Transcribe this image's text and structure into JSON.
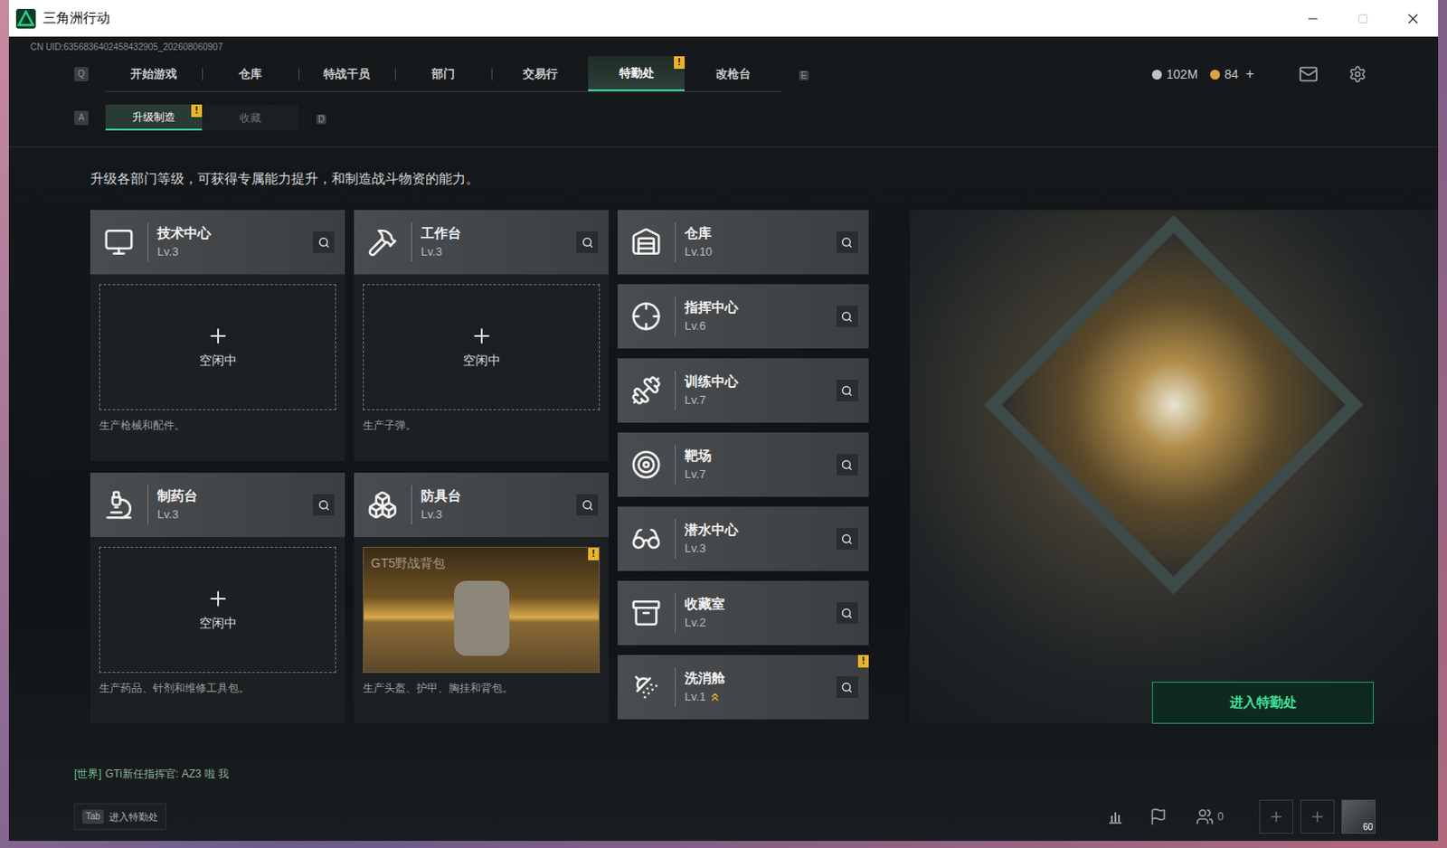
{
  "window": {
    "title": "三角洲行动"
  },
  "uid": "CN UID:6356836402458432905_202608060907",
  "nav": {
    "prev_key": "Q",
    "next_key": "E",
    "tabs": [
      {
        "label": "开始游戏",
        "selected": false
      },
      {
        "label": "仓库",
        "selected": false
      },
      {
        "label": "特战干员",
        "selected": false
      },
      {
        "label": "部门",
        "selected": false
      },
      {
        "label": "交易行",
        "selected": false
      },
      {
        "label": "特勤处",
        "selected": true,
        "badge": "!"
      },
      {
        "label": "改枪台",
        "selected": false
      }
    ]
  },
  "wallet": {
    "currencies": [
      {
        "value": "102M",
        "color": "#bfc3c6"
      },
      {
        "value": "84",
        "color": "#d9a441"
      }
    ],
    "add": "+"
  },
  "subnav": {
    "prev_key": "A",
    "next_key": "D",
    "tabs": [
      {
        "label": "升级制造",
        "selected": true,
        "badge": "!"
      },
      {
        "label": "收藏",
        "selected": false
      }
    ]
  },
  "description": "升级各部门等级，可获得专属能力提升，和制造战斗物资的能力。",
  "stations": [
    {
      "name": "技术中心",
      "level": "Lv.3",
      "slot": {
        "kind": "idle",
        "label": "空闲中"
      },
      "desc": "生产枪械和配件。"
    },
    {
      "name": "工作台",
      "level": "Lv.3",
      "slot": {
        "kind": "idle",
        "label": "空闲中"
      },
      "desc": "生产子弹。"
    },
    {
      "name": "制药台",
      "level": "Lv.3",
      "slot": {
        "kind": "idle",
        "label": "空闲中"
      },
      "desc": "生产药品、针剂和维修工具包。"
    },
    {
      "name": "防具台",
      "level": "Lv.3",
      "slot": {
        "kind": "item",
        "label": "GT5野战背包",
        "badge": "!"
      },
      "desc": "生产头盔、护甲、胸挂和背包。"
    }
  ],
  "departments": [
    {
      "name": "仓库",
      "level": "Lv.10",
      "upgradable": false
    },
    {
      "name": "指挥中心",
      "level": "Lv.6",
      "upgradable": false
    },
    {
      "name": "训练中心",
      "level": "Lv.7",
      "upgradable": false
    },
    {
      "name": "靶场",
      "level": "Lv.7",
      "upgradable": false
    },
    {
      "name": "潜水中心",
      "level": "Lv.3",
      "upgradable": false
    },
    {
      "name": "收藏室",
      "level": "Lv.2",
      "upgradable": false
    },
    {
      "name": "洗消舱",
      "level": "Lv.1",
      "upgradable": true,
      "badge": "!"
    }
  ],
  "enter_button": "进入特勤处",
  "chat": {
    "channel": "[世界]",
    "message": "GTi新任指挥官: AZ3 啦 我"
  },
  "hint": {
    "key": "Tab",
    "label": "进入特勤处"
  },
  "toolbar": {
    "friends": "0",
    "avatar_level": "60"
  }
}
